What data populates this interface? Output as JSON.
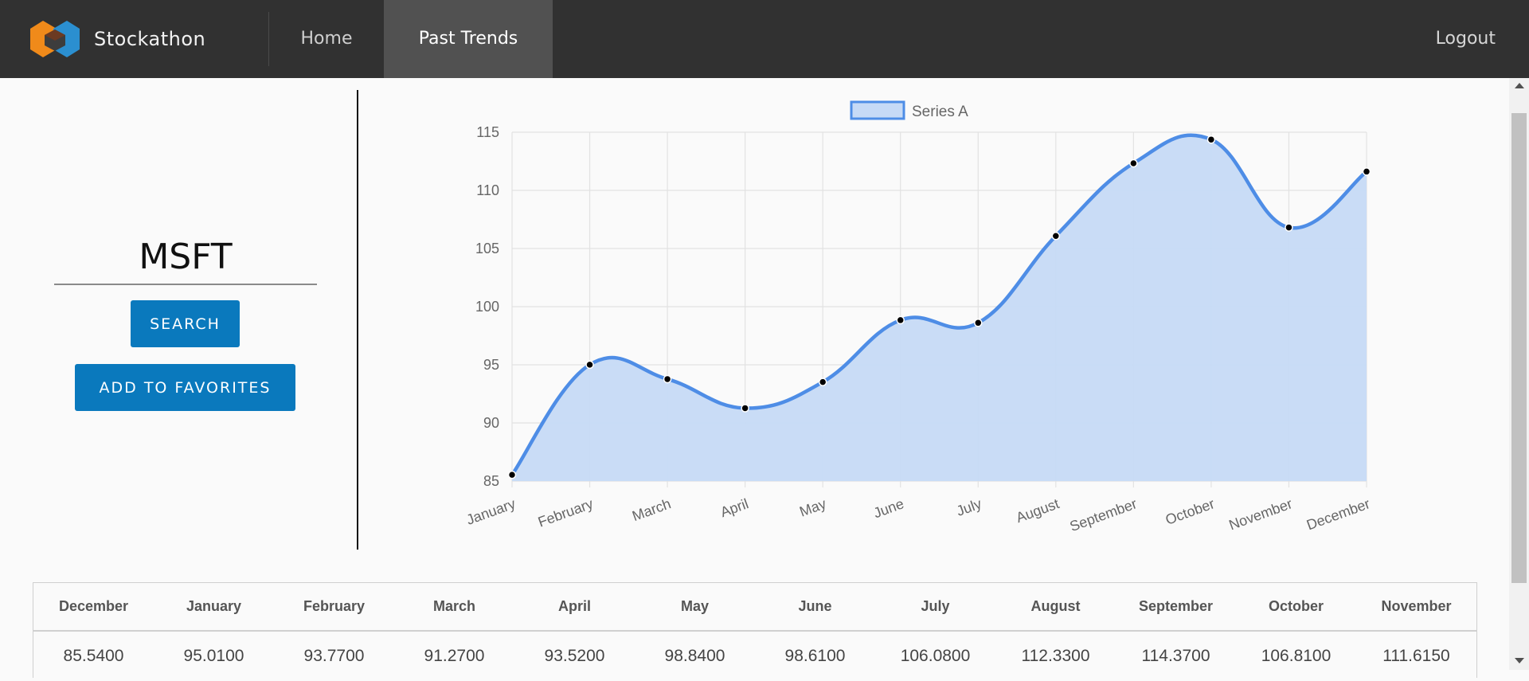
{
  "header": {
    "brand": "Stockathon",
    "nav": {
      "home": "Home",
      "past_trends": "Past Trends",
      "logout": "Logout"
    }
  },
  "search": {
    "value": "MSFT",
    "search_label": "SEARCH",
    "favorites_label": "ADD TO FAVORITES"
  },
  "colors": {
    "header_bg": "#313131",
    "active_nav_bg": "#515151",
    "button": "#0a79bd",
    "series_line": "#4e8de6",
    "series_fill": "#c6daf6"
  },
  "chart_data": {
    "type": "area",
    "legend": [
      "Series A"
    ],
    "legend_position": "top",
    "categories": [
      "January",
      "February",
      "March",
      "April",
      "May",
      "June",
      "July",
      "August",
      "September",
      "October",
      "November",
      "December"
    ],
    "series": [
      {
        "name": "Series A",
        "values": [
          85.54,
          95.01,
          93.77,
          91.27,
          93.52,
          98.84,
          98.61,
          106.08,
          112.33,
          114.37,
          106.81,
          111.615
        ]
      }
    ],
    "ylim": [
      85,
      115
    ],
    "yticks": [
      85,
      90,
      95,
      100,
      105,
      110,
      115
    ],
    "grid": true
  },
  "table": {
    "headers": [
      "December",
      "January",
      "February",
      "March",
      "April",
      "May",
      "June",
      "July",
      "August",
      "September",
      "October",
      "November"
    ],
    "values": [
      "85.5400",
      "95.0100",
      "93.7700",
      "91.2700",
      "93.5200",
      "98.8400",
      "98.6100",
      "106.0800",
      "112.3300",
      "114.3700",
      "106.8100",
      "111.6150"
    ]
  }
}
